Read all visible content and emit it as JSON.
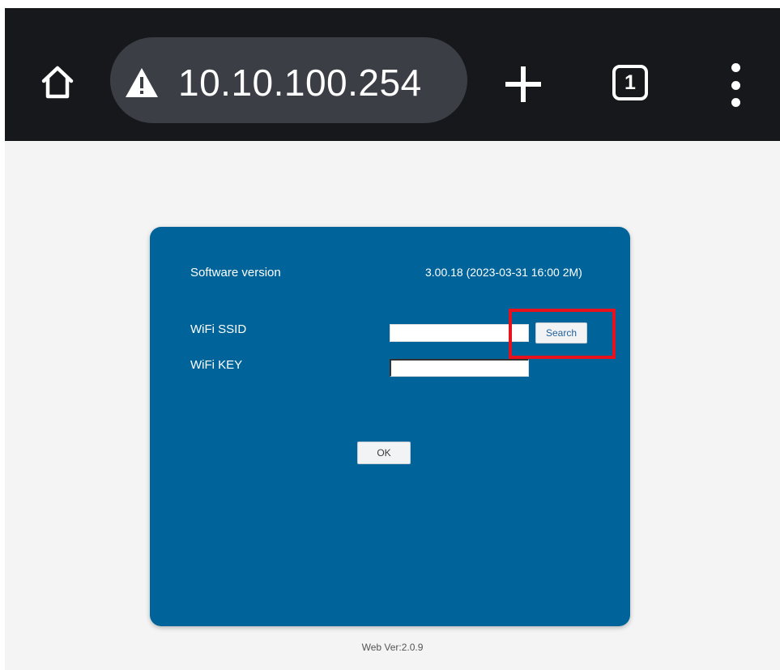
{
  "browser": {
    "address": "10.10.100.254",
    "tab_count": "1",
    "icons": {
      "home": "home-icon",
      "security": "warning-triangle-icon",
      "new_tab": "plus-icon",
      "tabs": "tab-switcher-icon",
      "menu": "kebab-menu-icon"
    }
  },
  "form": {
    "software_version_label": "Software version",
    "software_version_value": "3.00.18 (2023-03-31 16:00 2M)",
    "ssid_label": "WiFi SSID",
    "ssid_value": "",
    "search_button": "Search",
    "key_label": "WiFi KEY",
    "key_value": "",
    "ok_button": "OK"
  },
  "footer": {
    "web_version": "Web Ver:2.0.9"
  },
  "colors": {
    "toolbar": "#16181b",
    "url_pill": "#3b3e45",
    "card": "#00649a",
    "page": "#f4f4f4",
    "highlight": "#e8121d"
  }
}
